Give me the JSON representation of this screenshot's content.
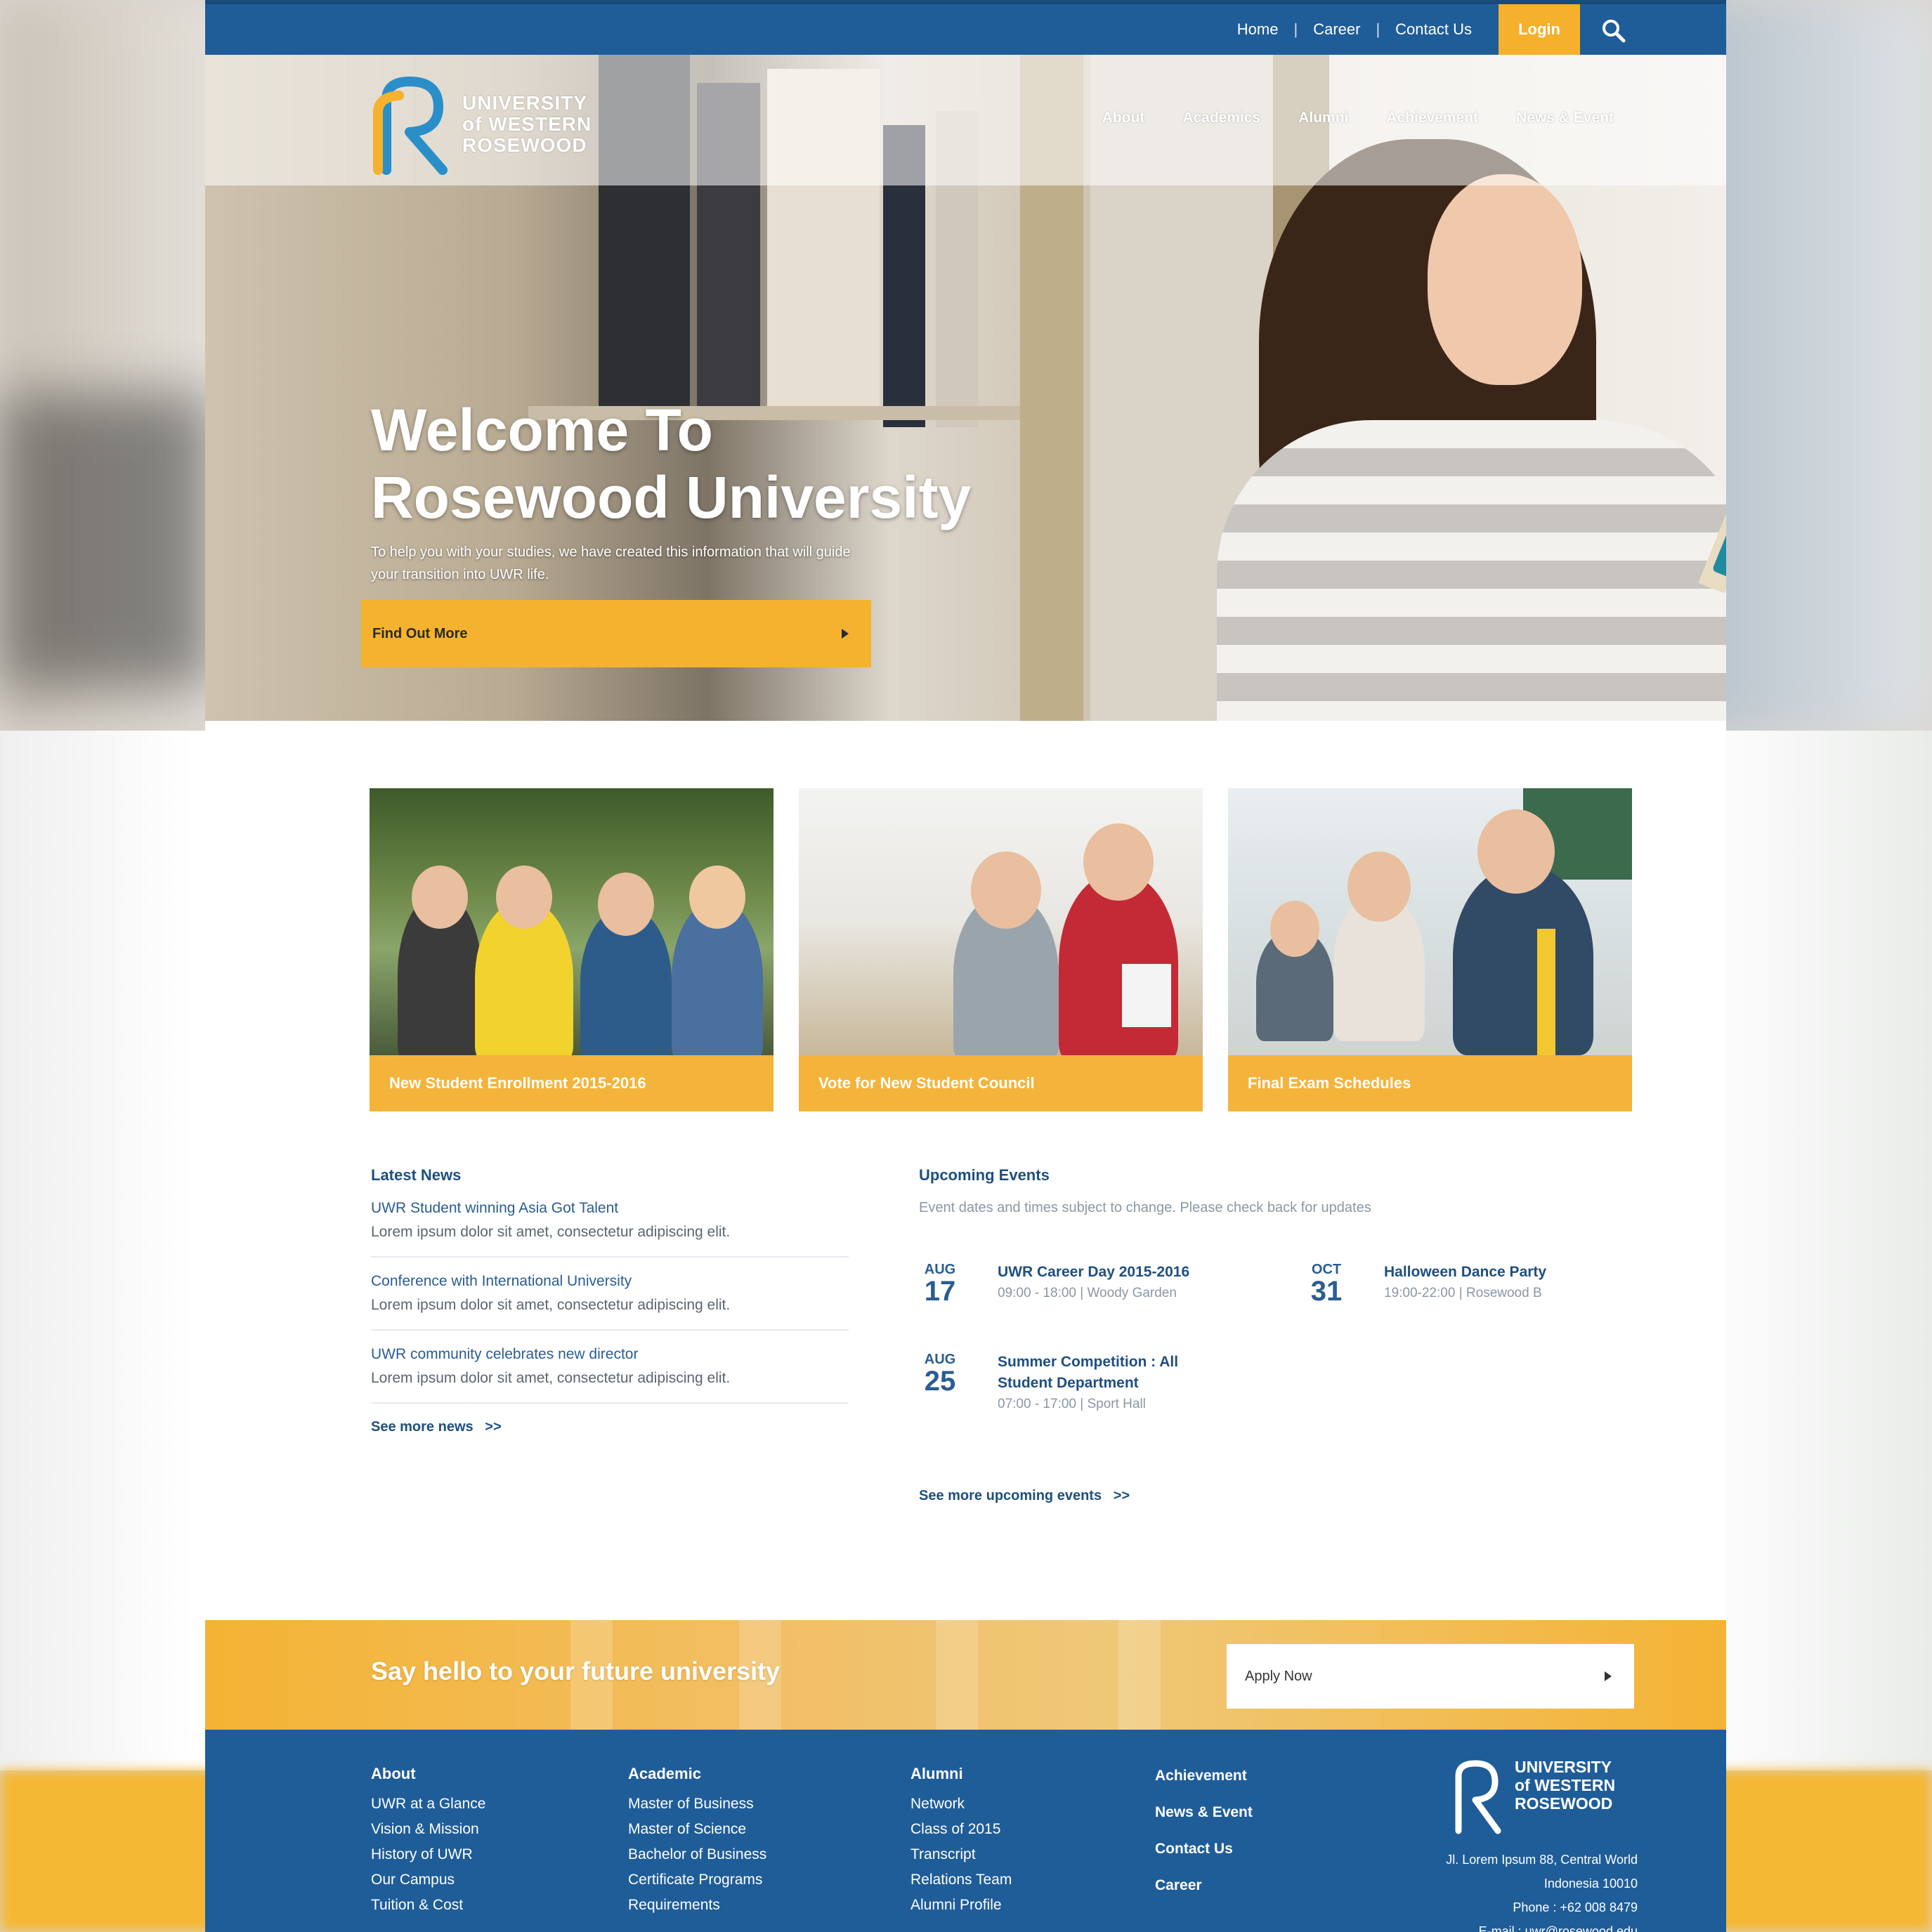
{
  "topbar": {
    "links": [
      "Home",
      "Career",
      "Contact Us"
    ],
    "separator": "|",
    "login_label": "Login",
    "search_icon": "search-icon"
  },
  "brand": {
    "logo_letter": "R",
    "name_lines": [
      "UNIVERSITY",
      "of WESTERN",
      "ROSEWOOD"
    ],
    "colors": {
      "blue": "#1f5d99",
      "yellow": "#f5b22e"
    }
  },
  "main_nav": [
    "About",
    "Academics",
    "Alumni",
    "Achievement",
    "News & Event"
  ],
  "hero": {
    "title_line1": "Welcome To",
    "title_line2": "Rosewood University",
    "subtitle": "To help you with your studies, we have created this information that will guide your transition into UWR life.",
    "cta_label": "Find Out More",
    "cta_icon": "arrow-right-icon"
  },
  "cards": [
    {
      "caption": "New Student Enrollment 2015-2016"
    },
    {
      "caption": "Vote for New Student Council"
    },
    {
      "caption": "Final Exam Schedules"
    }
  ],
  "news": {
    "heading": "Latest News",
    "items": [
      {
        "title": "UWR Student winning Asia Got Talent",
        "body": "Lorem ipsum dolor sit amet, consectetur adipiscing elit."
      },
      {
        "title": "Conference with International University",
        "body": "Lorem ipsum dolor sit amet, consectetur adipiscing elit."
      },
      {
        "title": "UWR community celebrates new director",
        "body": "Lorem ipsum dolor sit amet, consectetur adipiscing elit."
      }
    ],
    "more_label": "See more news",
    "more_arrow": ">>"
  },
  "events": {
    "heading": "Upcoming Events",
    "note": "Event dates and times subject to change. Please check back for updates",
    "items": [
      {
        "month": "AUG",
        "day": "17",
        "title": "UWR Career Day 2015-2016",
        "details": "09:00 - 18:00 | Woody Garden"
      },
      {
        "month": "OCT",
        "day": "31",
        "title": "Halloween Dance Party",
        "details": "19:00-22:00 | Rosewood B"
      },
      {
        "month": "AUG",
        "day": "25",
        "title": "Summer Competition : All Student Department",
        "details": "07:00 - 17:00 | Sport Hall"
      }
    ],
    "more_label": "See more upcoming events",
    "more_arrow": ">>"
  },
  "cta": {
    "text": "Say hello to your future university",
    "button_label": "Apply Now",
    "button_icon": "arrow-right-icon"
  },
  "footer": {
    "columns": [
      {
        "heading": "About",
        "items": [
          "UWR at a Glance",
          "Vision & Mission",
          "History of UWR",
          "Our Campus",
          "Tuition & Cost"
        ]
      },
      {
        "heading": "Academic",
        "items": [
          "Master of Business",
          "Master of Science",
          "Bachelor of Business",
          "Certificate Programs",
          "Requirements"
        ]
      },
      {
        "heading": "Alumni",
        "items": [
          "Network",
          "Class of 2015",
          "Transcript",
          "Relations Team",
          "Alumni Profile"
        ]
      }
    ],
    "links": [
      "Achievement",
      "News & Event",
      "Contact Us",
      "Career"
    ],
    "address_lines": [
      "Jl. Lorem Ipsum 88, Central World",
      "Indonesia 10010",
      "Phone : +62 008 8479",
      "E-mail : uwr@rosewood.edu"
    ]
  }
}
